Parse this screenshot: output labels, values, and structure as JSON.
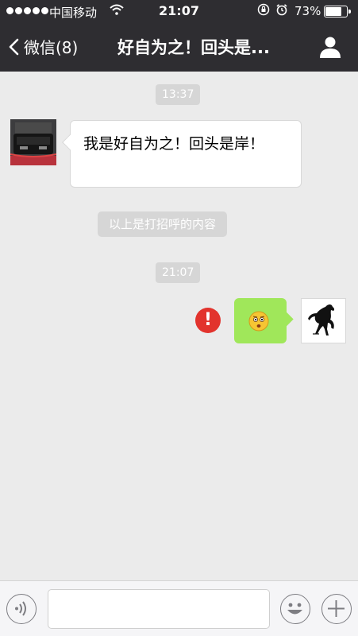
{
  "status_bar": {
    "carrier": "中国移动",
    "time": "21:07",
    "battery_percent": "73%",
    "battery_level": 0.73
  },
  "nav": {
    "back_label": "微信(8)",
    "title": "好自为之！回头是..."
  },
  "messages": {
    "timestamp_1": "13:37",
    "incoming_text": "我是好自为之！回头是岸！",
    "system_notice": "以上是打招呼的内容",
    "timestamp_2": "21:07"
  },
  "icons": {
    "back": "chevron-left-icon",
    "profile": "person-icon",
    "error": "exclamation-icon",
    "emoji": "surprised-face-icon",
    "voice": "voice-icon",
    "emoji_button": "smiley-icon",
    "plus": "plus-icon"
  },
  "colors": {
    "nav_bg": "#2e2d31",
    "chat_bg": "#ebebeb",
    "outgoing_bubble": "#a0e75a",
    "error_red": "#e2332d"
  }
}
